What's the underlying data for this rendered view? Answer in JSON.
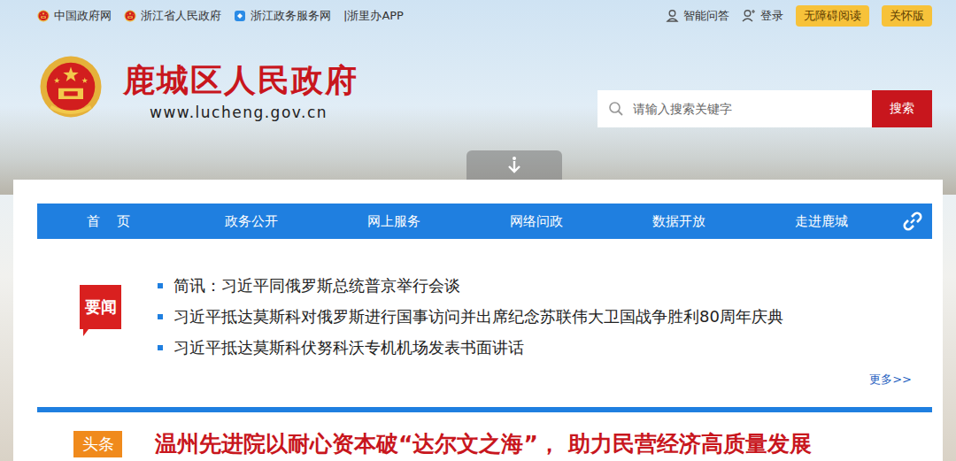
{
  "top_links": [
    {
      "label": "中国政府网",
      "kind": "emblem"
    },
    {
      "label": "浙江省人民政府",
      "kind": "emblem"
    },
    {
      "label": "浙江政务服务网",
      "kind": "service"
    },
    {
      "label": "|浙里办APP",
      "kind": "plain"
    }
  ],
  "top_right": {
    "qa": "智能问答",
    "login": "登录",
    "buttons": [
      "无障碍阅读",
      "关怀版"
    ]
  },
  "site": {
    "title": "鹿城区人民政府",
    "url": "www.lucheng.gov.cn"
  },
  "search": {
    "placeholder": "请输入搜索关键字",
    "button": "搜索"
  },
  "nav": [
    {
      "label": "首    页",
      "selected": false
    },
    {
      "label": "政务公开",
      "selected": false
    },
    {
      "label": "网上服务",
      "selected": false
    },
    {
      "label": "网络问政",
      "selected": false
    },
    {
      "label": "数据开放",
      "selected": false
    },
    {
      "label": "走进鹿城",
      "selected": false
    }
  ],
  "news": {
    "badge": "要闻",
    "items": [
      "简讯：习近平同俄罗斯总统普京举行会谈",
      "习近平抵达莫斯科对俄罗斯进行国事访问并出席纪念苏联伟大卫国战争胜利80周年庆典",
      "习近平抵达莫斯科伏努科沃专机机场发表书面讲话"
    ],
    "more": "更多>>"
  },
  "headline": {
    "badge": "头条",
    "title": "温州先进院以耐心资本破“达尔文之海”， 助力民营经济高质量发展"
  }
}
